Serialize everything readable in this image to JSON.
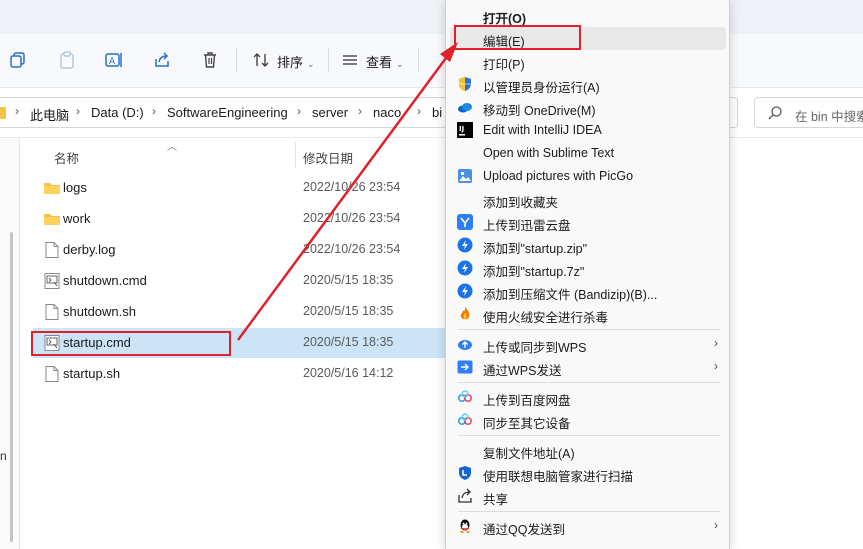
{
  "toolbar": {
    "sort_label": "排序",
    "view_label": "查看"
  },
  "address": {
    "crumbs": [
      "此电脑",
      "Data (D:)",
      "SoftwareEngineering",
      "server",
      "naco",
      "bi"
    ],
    "search_placeholder": "在 bin 中搜索"
  },
  "columns": {
    "name": "名称",
    "modified": "修改日期"
  },
  "nav_fragment": "n",
  "files": [
    {
      "name": "logs",
      "date": "2022/10/26 23:54",
      "kind": "folder"
    },
    {
      "name": "work",
      "date": "2022/10/26 23:54",
      "kind": "folder"
    },
    {
      "name": "derby.log",
      "date": "2022/10/26 23:54",
      "kind": "file"
    },
    {
      "name": "shutdown.cmd",
      "date": "2020/5/15 18:35",
      "kind": "cmd"
    },
    {
      "name": "shutdown.sh",
      "date": "2020/5/15 18:35",
      "kind": "file"
    },
    {
      "name": "startup.cmd",
      "date": "2020/5/15 18:35",
      "kind": "cmd"
    },
    {
      "name": "startup.sh",
      "date": "2020/5/16 14:12",
      "kind": "file"
    }
  ],
  "menu": [
    {
      "label": "打开(O)",
      "icon": "none",
      "bold": true
    },
    {
      "label": "编辑(E)",
      "icon": "none",
      "highlight": true
    },
    {
      "label": "打印(P)",
      "icon": "none"
    },
    {
      "label": "以管理员身份运行(A)",
      "icon": "uac-shield-icon"
    },
    {
      "label": "移动到 OneDrive(M)",
      "icon": "onedrive-icon"
    },
    {
      "label": "Edit with IntelliJ IDEA",
      "icon": "intellij-icon"
    },
    {
      "label": "Open with Sublime Text",
      "icon": "none"
    },
    {
      "label": "Upload pictures with PicGo",
      "icon": "picgo-icon"
    },
    {
      "label": "添加到收藏夹",
      "icon": "none"
    },
    {
      "label": "上传到迅雷云盘",
      "icon": "xunlei-icon"
    },
    {
      "label": "添加到\"startup.zip\"",
      "icon": "bandizip-icon"
    },
    {
      "label": "添加到\"startup.7z\"",
      "icon": "bandizip-icon"
    },
    {
      "label": "添加到压缩文件 (Bandizip)(B)...",
      "icon": "bandizip-icon"
    },
    {
      "label": "使用火绒安全进行杀毒",
      "icon": "huorong-icon"
    },
    {
      "label": "上传或同步到WPS",
      "icon": "wps-cloud-icon",
      "submenu": true
    },
    {
      "label": "通过WPS发送",
      "icon": "wps-send-icon",
      "submenu": true
    },
    {
      "label": "上传到百度网盘",
      "icon": "baidu-netdisk-icon"
    },
    {
      "label": "同步至其它设备",
      "icon": "baidu-netdisk-icon"
    },
    {
      "label": "复制文件地址(A)",
      "icon": "none"
    },
    {
      "label": "使用联想电脑管家进行扫描",
      "icon": "lenovo-shield-icon"
    },
    {
      "label": "共享",
      "icon": "share-icon"
    },
    {
      "label": "通过QQ发送到",
      "icon": "qq-icon",
      "submenu": true
    }
  ],
  "colors": {
    "selection": "#cce4f7",
    "annotation_red": "#e0202a",
    "folder": "#f3c247"
  }
}
